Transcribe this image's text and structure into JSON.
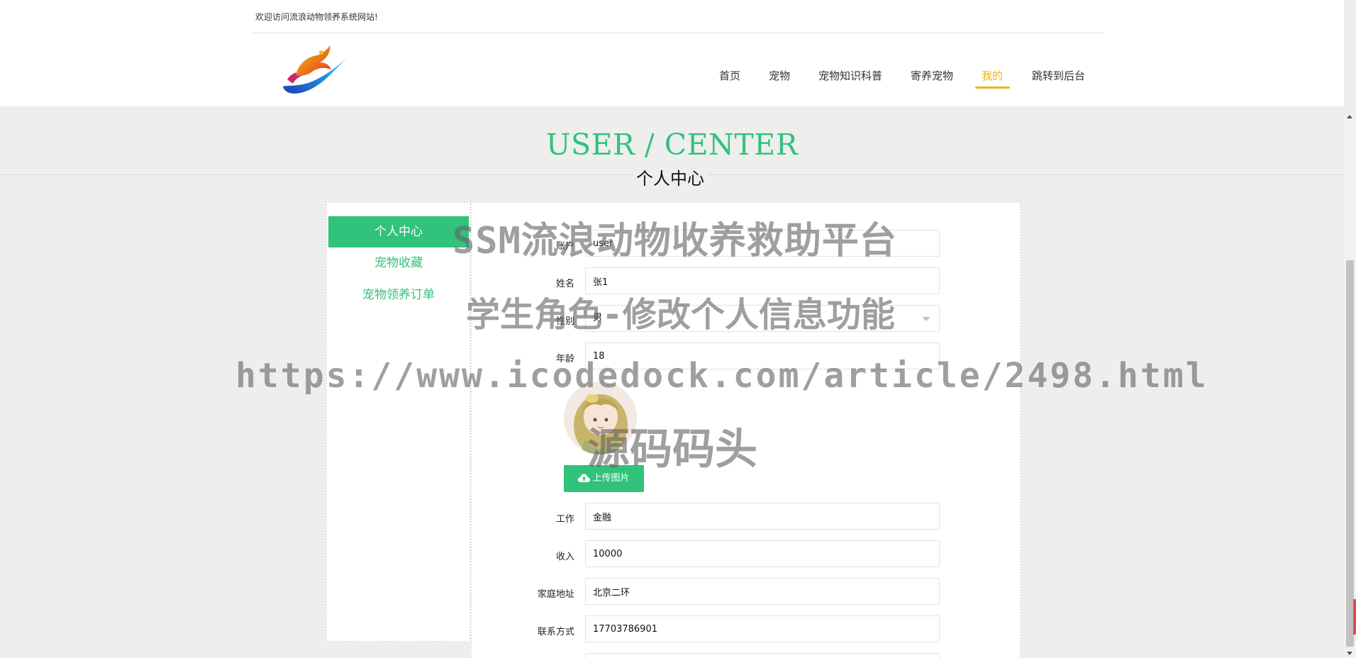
{
  "header": {
    "welcome_text": "欢迎访问流浪动物领养系统网站!",
    "logo_icon": "logo-dragon-swoosh"
  },
  "nav": {
    "items": [
      {
        "label": "首页"
      },
      {
        "label": "宠物"
      },
      {
        "label": "宠物知识科普"
      },
      {
        "label": "寄养宠物"
      },
      {
        "label": "我的"
      },
      {
        "label": "跳转到后台"
      }
    ],
    "active_item": "我的",
    "active_color": "#e6b422"
  },
  "page": {
    "title": "USER / CENTER",
    "subtitle": "个人中心",
    "accent_color": "#31c27c"
  },
  "sidebar": {
    "items": [
      {
        "label": "个人中心"
      },
      {
        "label": "宠物收藏"
      },
      {
        "label": "宠物领养订单"
      }
    ],
    "active_item": "个人中心"
  },
  "form": {
    "account": {
      "label": "账户",
      "value": "user"
    },
    "name": {
      "label": "姓名",
      "value": "张1"
    },
    "gender": {
      "label": "性别",
      "value": "男"
    },
    "age": {
      "label": "年龄",
      "value": "18"
    },
    "upload_button": "上传图片",
    "upload_icon": "cloud-upload-icon",
    "job": {
      "label": "工作",
      "value": "金融"
    },
    "income": {
      "label": "收入",
      "value": "10000"
    },
    "address": {
      "label": "家庭地址",
      "value": "北京二环"
    },
    "contact": {
      "label": "联系方式",
      "value": "17703786901"
    }
  },
  "watermark": {
    "line1": "SSM流浪动物收养救助平台",
    "line2": "学生角色-修改个人信息功能",
    "line3": "https://www.icodedock.com/article/2498.html",
    "line4": "源码码头"
  }
}
